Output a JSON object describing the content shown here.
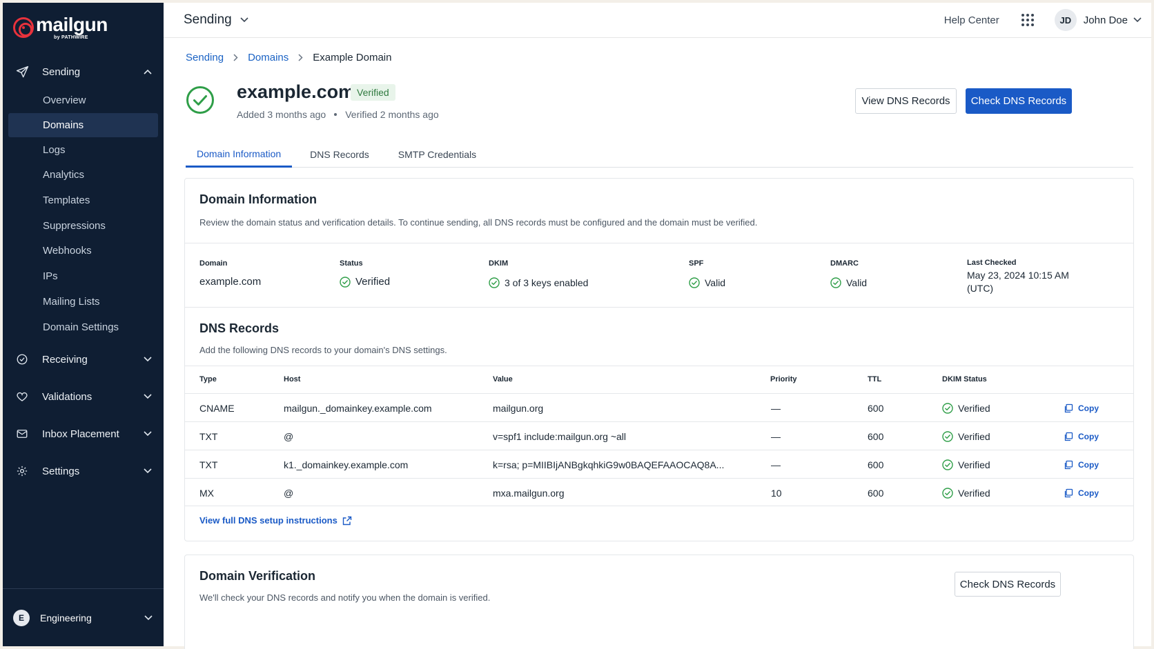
{
  "brand": {
    "name": "mailgun",
    "sub": "by PATHWIRE",
    "color": "#e8323c"
  },
  "sidebar": {
    "sections": [
      {
        "label": "Sending",
        "icon": "send-icon"
      },
      {
        "label": "Receiving",
        "icon": "receiving-icon"
      },
      {
        "label": "Validations",
        "icon": "heart-icon"
      },
      {
        "label": "Inbox Placement",
        "icon": "mail-icon"
      },
      {
        "label": "Settings",
        "icon": "gear-icon"
      }
    ],
    "items": [
      "Overview",
      "Domains",
      "Logs",
      "Analytics",
      "Templates",
      "Suppressions",
      "Webhooks",
      "IPs",
      "Mailing Lists",
      "Domain Settings"
    ],
    "active_item": "Domains",
    "org": {
      "initial": "E",
      "name": "Engineering"
    }
  },
  "topbar": {
    "title": "Sending",
    "help": "Help Center",
    "user": {
      "initials": "JD",
      "name": "John Doe"
    }
  },
  "breadcrumb": [
    "Sending",
    "Domains",
    "Example Domain"
  ],
  "header": {
    "domain": "example.com",
    "badge": "Verified",
    "added": "Added 3 months ago",
    "verified": "Verified 2 months ago",
    "view_btn": "View DNS Records",
    "check_btn": "Check DNS Records"
  },
  "tabs": [
    "Domain Information",
    "DNS Records",
    "SMTP Credentials"
  ],
  "domain_info": {
    "title": "Domain Information",
    "desc": "Review the domain status and verification details. To continue sending, all DNS records must be configured and the domain must be verified.",
    "fields": [
      {
        "label": "Domain",
        "value": "example.com"
      },
      {
        "label": "Status",
        "value": "Verified"
      },
      {
        "label": "DKIM",
        "value": "3 of 3 keys enabled"
      },
      {
        "label": "SPF",
        "value": "Valid"
      },
      {
        "label": "DMARC",
        "value": "Valid"
      },
      {
        "label": "Last Checked",
        "value": "May 23, 2024 10:15 AM",
        "value2": "(UTC)"
      }
    ]
  },
  "dns": {
    "title": "DNS Records",
    "desc": "Add the following DNS records to your domain's DNS settings.",
    "columns": [
      "Type",
      "Host",
      "Value",
      "Priority",
      "TTL",
      "DKIM Status"
    ],
    "rows": [
      {
        "type": "CNAME",
        "host": "mailgun._domainkey.example.com",
        "value": "mailgun.org",
        "priority": "—",
        "ttl": "600",
        "status": "Verified",
        "action": "Copy"
      },
      {
        "type": "TXT",
        "host": "@",
        "value": "v=spf1 include:mailgun.org ~all",
        "priority": "—",
        "ttl": "600",
        "status": "Verified",
        "action": "Copy"
      },
      {
        "type": "TXT",
        "host": "k1._domainkey.example.com",
        "value": "k=rsa; p=MIIBIjANBgkqhkiG9w0BAQEFAAOCAQ8A...",
        "priority": "—",
        "ttl": "600",
        "status": "Verified",
        "action": "Copy"
      },
      {
        "type": "MX",
        "host": "@",
        "value": "mxa.mailgun.org",
        "priority": "10",
        "ttl": "600",
        "status": "Verified",
        "action": "Copy"
      }
    ],
    "link": "View full DNS setup instructions"
  },
  "verification": {
    "title": "Domain Verification",
    "desc": "We'll check your DNS records and notify you when the domain is verified.",
    "button": "Check DNS Records"
  },
  "colors": {
    "sidebar_bg": "#0f1e33",
    "accent": "#1a5ac6",
    "success": "#2f9e48"
  }
}
